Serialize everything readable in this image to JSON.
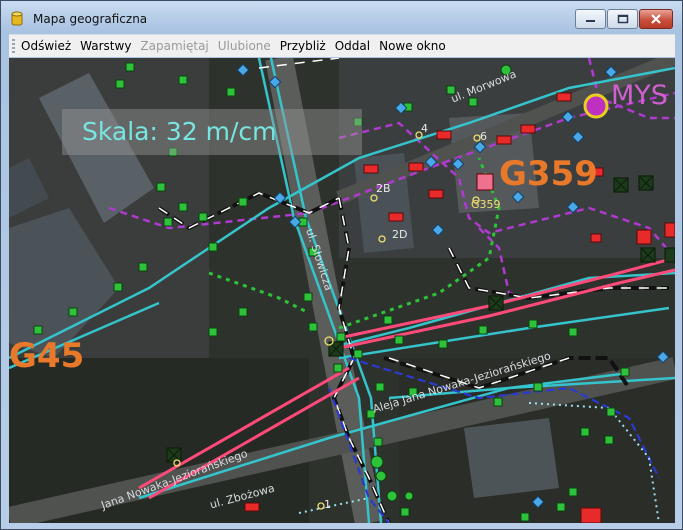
{
  "window": {
    "title": "Mapa geograficzna",
    "buttons": {
      "minimize_icon": "minimize-icon",
      "maximize_icon": "maximize-icon",
      "close_icon": "close-icon"
    }
  },
  "menu": {
    "items": [
      "Odśwież",
      "Warstwy",
      "Zapamiętaj",
      "Ulubione",
      "Przybliż",
      "Oddal",
      "Nowe okno"
    ],
    "disabled": [
      "Zapamiętaj",
      "Ulubione"
    ]
  },
  "map": {
    "scale": "Skala: 32 m/cm",
    "labels": {
      "g359_big": "G359",
      "g359_small": "G359",
      "g45": "G45",
      "mys": "MYS",
      "n2b": "2B",
      "n2d": "2D",
      "n4": "4",
      "n6": "6",
      "n1": "1"
    },
    "streets": {
      "street_north": "ul. Morwowa",
      "street_vertical": "ul. Słowicza",
      "street_aleja": "Aleja Jana Nowaka-Jeziorańskiego",
      "street_aleja_left": "Jana Nowaka-Jeziorańskiego",
      "street_zbozowa": "ul. Zbożowa"
    },
    "colors": {
      "pipe_cyan": "#35c4cc",
      "pipe_red": "#ff4a7a",
      "marker_green": "#2ec23a",
      "marker_blue": "#4aa8e8",
      "marker_red": "#e82a2a",
      "boundary_purple": "#b03ad0",
      "label_orange": "#e8792a"
    }
  }
}
